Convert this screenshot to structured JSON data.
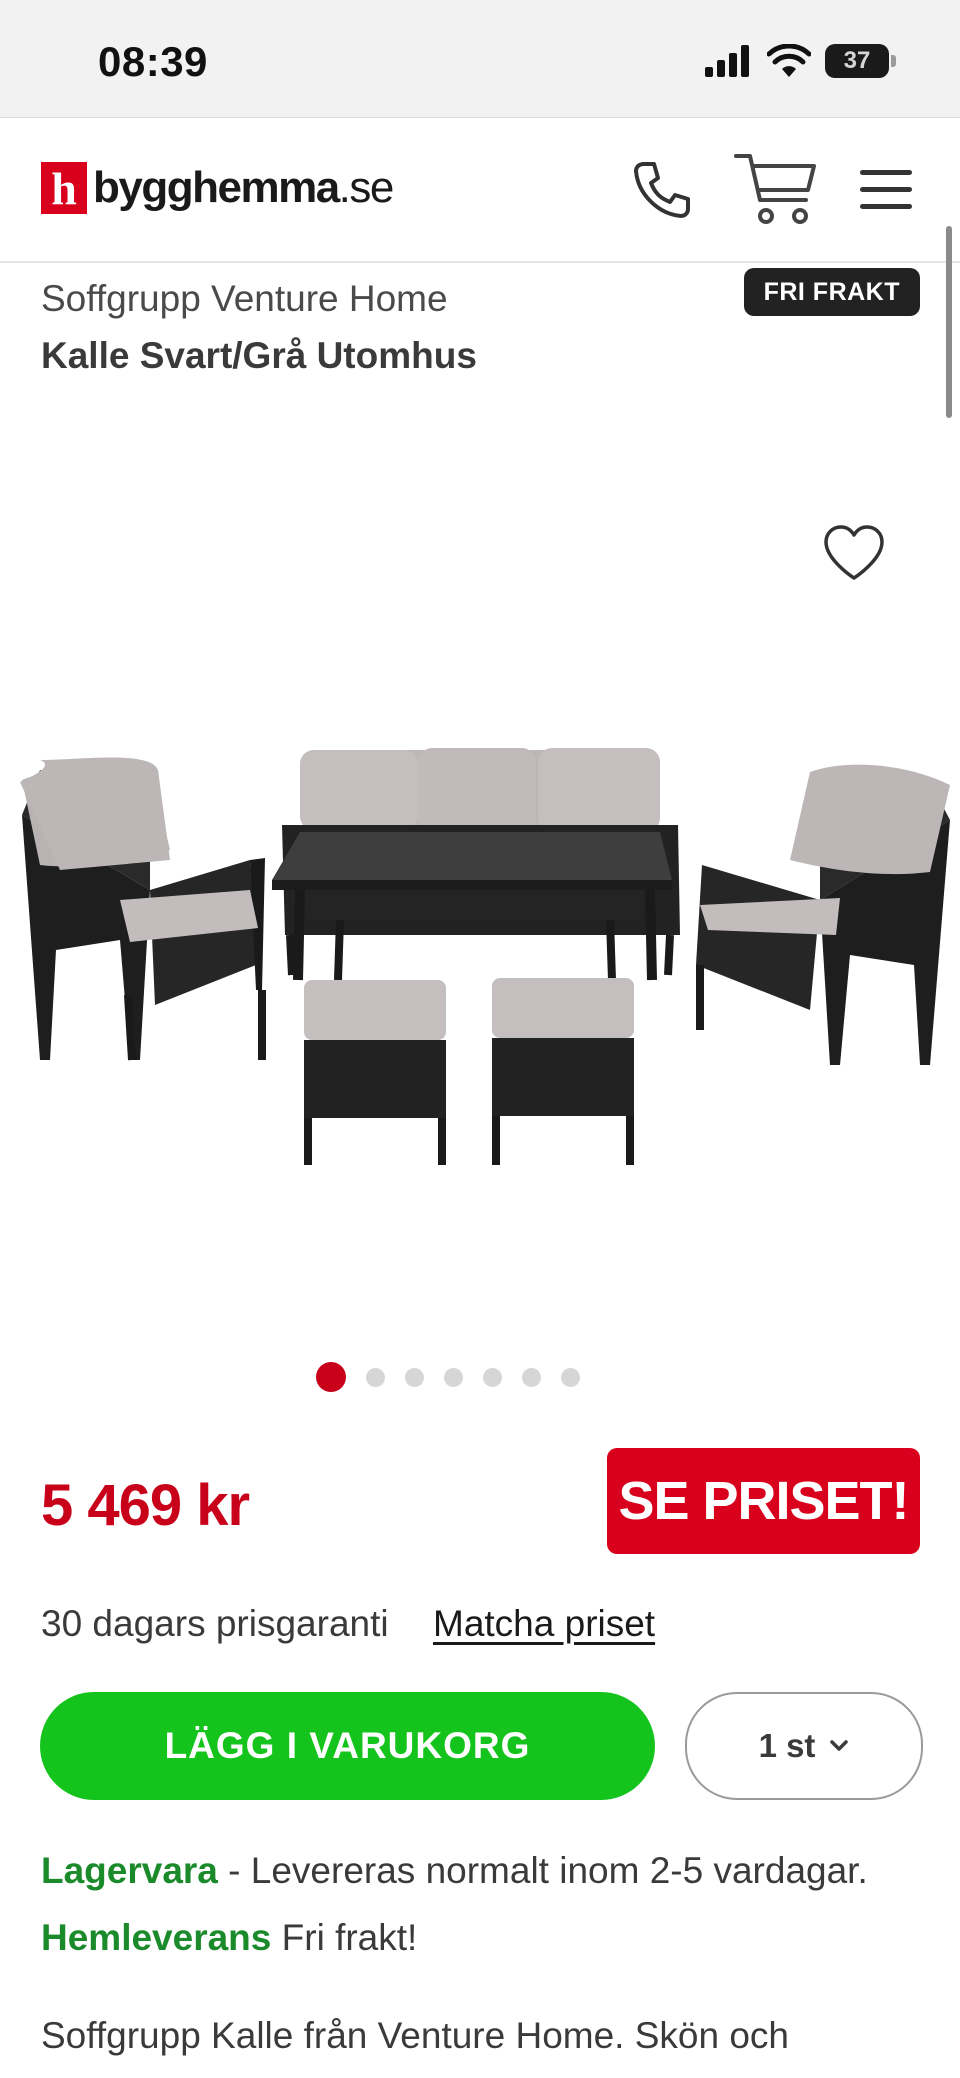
{
  "status_bar": {
    "time": "08:39",
    "battery_level": "37"
  },
  "header": {
    "logo_text": "bygghemma",
    "logo_domain": ".se",
    "icons": [
      "phone-icon",
      "cart-icon",
      "menu-icon"
    ]
  },
  "product": {
    "brand_line": "Soffgrupp Venture Home",
    "name": "Kalle Svart/Grå Utomhus",
    "badge": "FRI FRAKT",
    "gallery": {
      "image_count": 7,
      "active_index": 0
    },
    "price": "5 469 kr",
    "price_button": "SE PRISET!",
    "guarantee_text": "30 dagars prisgaranti",
    "match_link": "Matcha priset",
    "add_to_cart": "LÄGG I VARUKORG",
    "quantity": "1 st",
    "stock_label": "Lagervara",
    "stock_text": " - Levereras normalt inom 2-5 vardagar.",
    "delivery_label": "Hemleverans",
    "delivery_text": " Fri frakt!",
    "description": "Soffgrupp Kalle från Venture Home. Skön och"
  },
  "colors": {
    "brand_red": "#d8001c",
    "cta_green": "#14c41c",
    "stock_green": "#1a8a2a"
  }
}
